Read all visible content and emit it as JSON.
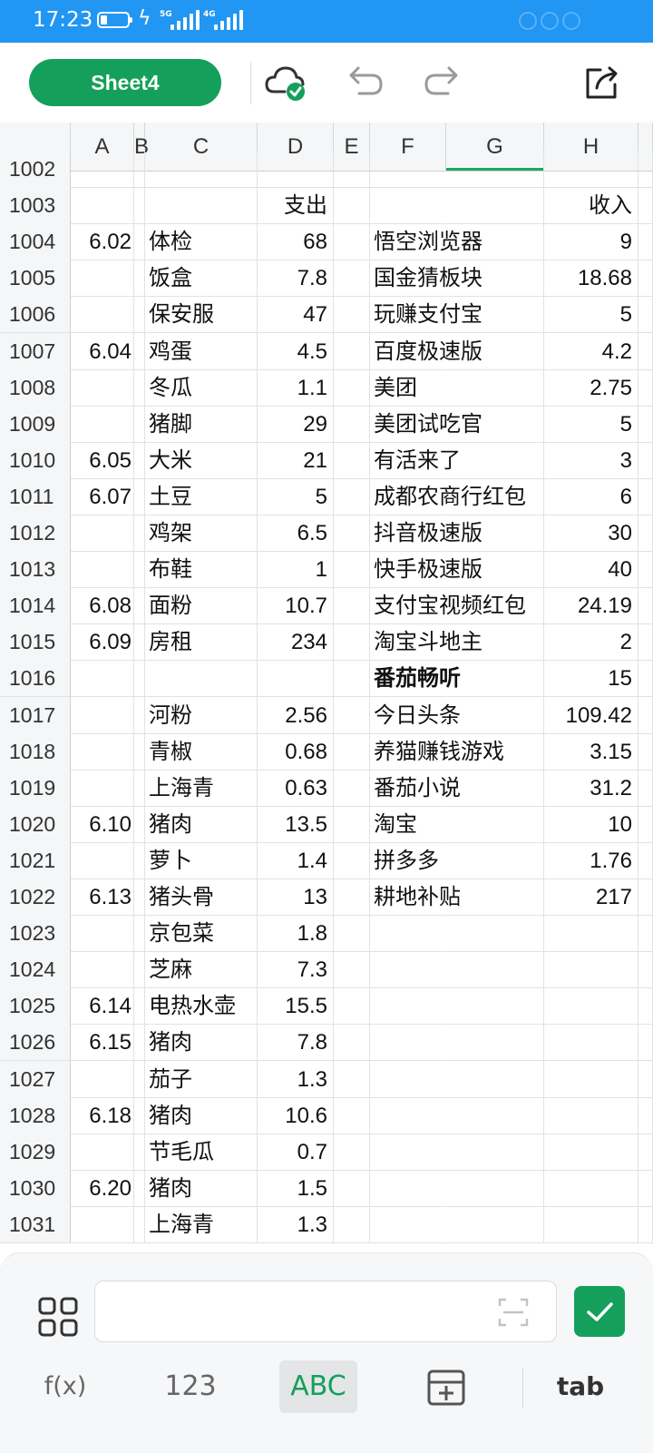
{
  "status": {
    "time": "17:23",
    "net1": "5G",
    "net2": "4G"
  },
  "toolbar": {
    "sheet_label": "Sheet4"
  },
  "columns": [
    "A",
    "B",
    "C",
    "D",
    "E",
    "F",
    "G",
    "H"
  ],
  "active_column": "G",
  "rows": [
    {
      "n": "1002",
      "a": "",
      "c": "",
      "d": "",
      "f": "",
      "h": ""
    },
    {
      "n": "1003",
      "a": "",
      "c": "",
      "d": "支出",
      "f": "",
      "h": "收入"
    },
    {
      "n": "1004",
      "a": "6.02",
      "c": "体检",
      "d": "68",
      "f": "悟空浏览器",
      "h": "9"
    },
    {
      "n": "1005",
      "a": "",
      "c": "饭盒",
      "d": "7.8",
      "f": "国金猜板块",
      "h": "18.68"
    },
    {
      "n": "1006",
      "a": "",
      "c": "保安服",
      "d": "47",
      "f": "玩赚支付宝",
      "h": "5"
    },
    {
      "n": "1007",
      "a": "6.04",
      "c": "鸡蛋",
      "d": "4.5",
      "f": "百度极速版",
      "h": "4.2"
    },
    {
      "n": "1008",
      "a": "",
      "c": "冬瓜",
      "d": "1.1",
      "f": "美团",
      "h": "2.75"
    },
    {
      "n": "1009",
      "a": "",
      "c": "猪脚",
      "d": "29",
      "f": "美团试吃官",
      "h": "5"
    },
    {
      "n": "1010",
      "a": "6.05",
      "c": "大米",
      "d": "21",
      "f": "有活来了",
      "h": "3"
    },
    {
      "n": "1011",
      "a": "6.07",
      "c": "土豆",
      "d": "5",
      "f": "成都农商行红包",
      "h": "6"
    },
    {
      "n": "1012",
      "a": "",
      "c": "鸡架",
      "d": "6.5",
      "f": "抖音极速版",
      "h": "30"
    },
    {
      "n": "1013",
      "a": "",
      "c": "布鞋",
      "d": "1",
      "f": "快手极速版",
      "h": "40"
    },
    {
      "n": "1014",
      "a": "6.08",
      "c": "面粉",
      "d": "10.7",
      "f": "支付宝视频红包",
      "h": "24.19"
    },
    {
      "n": "1015",
      "a": "6.09",
      "c": "房租",
      "d": "234",
      "f": "淘宝斗地主",
      "h": "2"
    },
    {
      "n": "1016",
      "a": "",
      "c": "",
      "d": "",
      "f": "番茄畅听",
      "h": "15",
      "bold": true
    },
    {
      "n": "1017",
      "a": "",
      "c": "河粉",
      "d": "2.56",
      "f": "今日头条",
      "h": "109.42"
    },
    {
      "n": "1018",
      "a": "",
      "c": "青椒",
      "d": "0.68",
      "f": "养猫赚钱游戏",
      "h": "3.15"
    },
    {
      "n": "1019",
      "a": "",
      "c": "上海青",
      "d": "0.63",
      "f": "番茄小说",
      "h": "31.2"
    },
    {
      "n": "1020",
      "a": "6.10",
      "c": "猪肉",
      "d": "13.5",
      "f": "淘宝",
      "h": "10"
    },
    {
      "n": "1021",
      "a": "",
      "c": "萝卜",
      "d": "1.4",
      "f": "拼多多",
      "h": "1.76"
    },
    {
      "n": "1022",
      "a": "6.13",
      "c": "猪头骨",
      "d": "13",
      "f": "耕地补贴",
      "h": "217"
    },
    {
      "n": "1023",
      "a": "",
      "c": "京包菜",
      "d": "1.8",
      "f": "",
      "h": ""
    },
    {
      "n": "1024",
      "a": "",
      "c": "芝麻",
      "d": "7.3",
      "f": "",
      "h": ""
    },
    {
      "n": "1025",
      "a": "6.14",
      "c": "电热水壶",
      "d": "15.5",
      "f": "",
      "h": ""
    },
    {
      "n": "1026",
      "a": "6.15",
      "c": "猪肉",
      "d": "7.8",
      "f": "",
      "h": ""
    },
    {
      "n": "1027",
      "a": "",
      "c": "茄子",
      "d": "1.3",
      "f": "",
      "h": ""
    },
    {
      "n": "1028",
      "a": "6.18",
      "c": "猪肉",
      "d": "10.6",
      "f": "",
      "h": ""
    },
    {
      "n": "1029",
      "a": "",
      "c": "节毛瓜",
      "d": "0.7",
      "f": "",
      "h": ""
    },
    {
      "n": "1030",
      "a": "6.20",
      "c": "猪肉",
      "d": "1.5",
      "f": "",
      "h": ""
    },
    {
      "n": "1031",
      "a": "",
      "c": "上海青",
      "d": "1.3",
      "f": "",
      "h": ""
    }
  ],
  "keyboard": {
    "tabs": [
      "f(x)",
      "123",
      "ABC",
      "",
      ""
    ],
    "selected": "ABC",
    "tab_key": "tab"
  },
  "input": {
    "value": ""
  },
  "colors": {
    "accent": "#14a05a",
    "status_bar": "#2196f3"
  }
}
